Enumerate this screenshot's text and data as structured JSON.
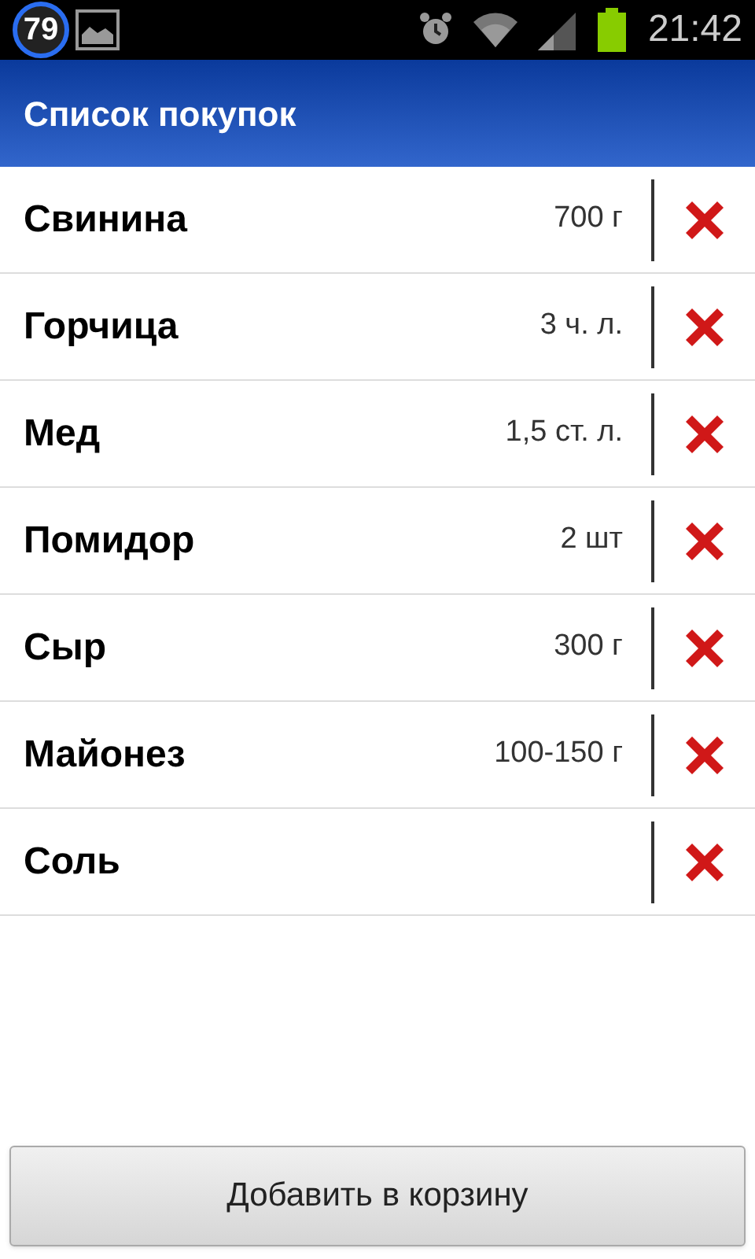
{
  "status_bar": {
    "badge": "79",
    "time": "21:42"
  },
  "app_bar": {
    "title": "Список покупок"
  },
  "items": [
    {
      "name": "Свинина",
      "amount": "700 г"
    },
    {
      "name": "Горчица",
      "amount": "3 ч. л."
    },
    {
      "name": "Мед",
      "amount": "1,5 ст. л."
    },
    {
      "name": "Помидор",
      "amount": "2 шт"
    },
    {
      "name": "Сыр",
      "amount": "300 г"
    },
    {
      "name": "Майонез",
      "amount": "100-150 г"
    },
    {
      "name": "Соль"
    }
  ],
  "button": "Добавить в корзину"
}
